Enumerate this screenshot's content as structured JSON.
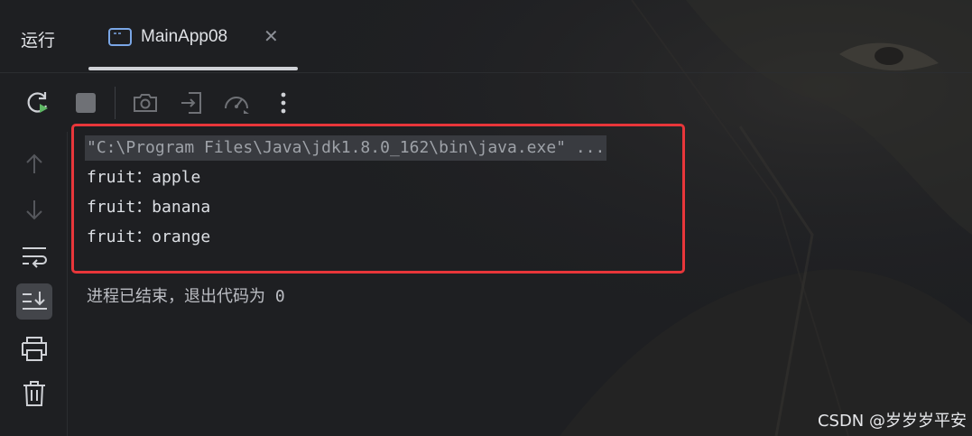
{
  "header": {
    "panel_title": "运行",
    "tab": {
      "label": "MainApp08",
      "close_symbol": "✕",
      "icon": "console-window-icon"
    }
  },
  "toolbar": {
    "buttons": [
      {
        "name": "rerun-icon"
      },
      {
        "name": "stop-icon"
      },
      {
        "name": "camera-icon"
      },
      {
        "name": "exit-to-icon"
      },
      {
        "name": "profiler-gauge-icon"
      },
      {
        "name": "more-options-icon"
      }
    ]
  },
  "sidebar": {
    "buttons": [
      {
        "name": "scroll-up-icon"
      },
      {
        "name": "scroll-down-icon"
      },
      {
        "name": "soft-wrap-icon"
      },
      {
        "name": "scroll-to-end-icon",
        "active": true
      },
      {
        "name": "print-icon"
      },
      {
        "name": "trash-icon"
      }
    ]
  },
  "console": {
    "command": "\"C:\\Program Files\\Java\\jdk1.8.0_162\\bin\\java.exe\" ...",
    "output_lines": [
      "fruit：apple",
      "fruit：banana",
      "fruit：orange"
    ],
    "exit_message": "进程已结束，退出代码为 0"
  },
  "watermark": "CSDN @岁岁岁平安",
  "colors": {
    "background": "#1e1f22",
    "highlight_border": "#e8363a",
    "rerun_accent": "#5fb865"
  }
}
